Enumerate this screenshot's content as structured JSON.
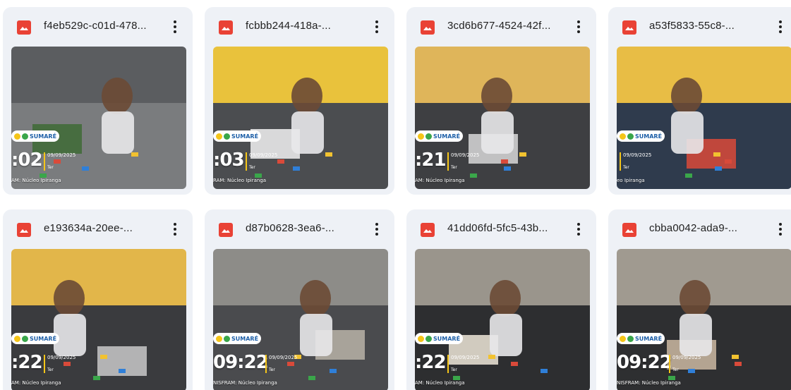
{
  "files": [
    {
      "name": "f4eb529c-c01d-478...",
      "stamp": {
        "time": ":02",
        "date": "09/09/2025",
        "day": "Ter",
        "location": "AM: Núcleo Ipiranga"
      },
      "palette": [
        "#5b5d60",
        "#7a7c7e",
        "#3e6b35"
      ]
    },
    {
      "name": "fcbbb244-418a-...",
      "stamp": {
        "time": ":03",
        "date": "09/09/2025",
        "day": "Ter",
        "location": "RAM: Núcleo Ipiranga"
      },
      "palette": [
        "#e9c23c",
        "#4b4d50",
        "#f2f2f2"
      ]
    },
    {
      "name": "3cd6b677-4524-42f...",
      "stamp": {
        "time": ":21",
        "date": "09/09/2025",
        "day": "Ter",
        "location": "AM: Núcleo Ipiranga"
      },
      "palette": [
        "#dfb55a",
        "#3e3f42",
        "#d8d8d8"
      ]
    },
    {
      "name": "a53f5833-55c8-...",
      "stamp": {
        "time": "",
        "date": "09/09/2025",
        "day": "Ter",
        "location": "eo Ipiranga"
      },
      "palette": [
        "#e8bd45",
        "#2f3b4d",
        "#d94a3a"
      ]
    },
    {
      "name": "e193634a-20ee-...",
      "stamp": {
        "time": ":22",
        "date": "09/09/2025",
        "day": "Ter",
        "location": "AM: Núcleo Ipiranga"
      },
      "palette": [
        "#e2b64a",
        "#3a3b3e",
        "#c9c9c9"
      ]
    },
    {
      "name": "d87b0628-3ea6-...",
      "stamp": {
        "time": "09:22",
        "date": "09/09/2025",
        "day": "Ter",
        "location": "NISFRAM: Núcleo Ipiranga"
      },
      "palette": [
        "#8d8c88",
        "#4a4b4e",
        "#b8b3a8"
      ]
    },
    {
      "name": "41dd06fd-5fc5-43b...",
      "stamp": {
        "time": ":22",
        "date": "09/09/2025",
        "day": "Ter",
        "location": "AM: Núcleo Ipiranga"
      },
      "palette": [
        "#9a958c",
        "#2d2e30",
        "#efe6d8"
      ]
    },
    {
      "name": "cbba0042-ada9-...",
      "stamp": {
        "time": "09:22",
        "date": "09/09/2025",
        "day": "Ter",
        "location": "NISFRAM: Núcleo Ipiranga"
      },
      "palette": [
        "#a09a90",
        "#2e2f31",
        "#cbb8a2"
      ]
    }
  ],
  "stamp_logos": {
    "brand": "SUMARÉ"
  },
  "colors": {
    "card_bg": "#eef1f6",
    "file_icon": "#e94235",
    "accent_bar": "#f5c518"
  }
}
